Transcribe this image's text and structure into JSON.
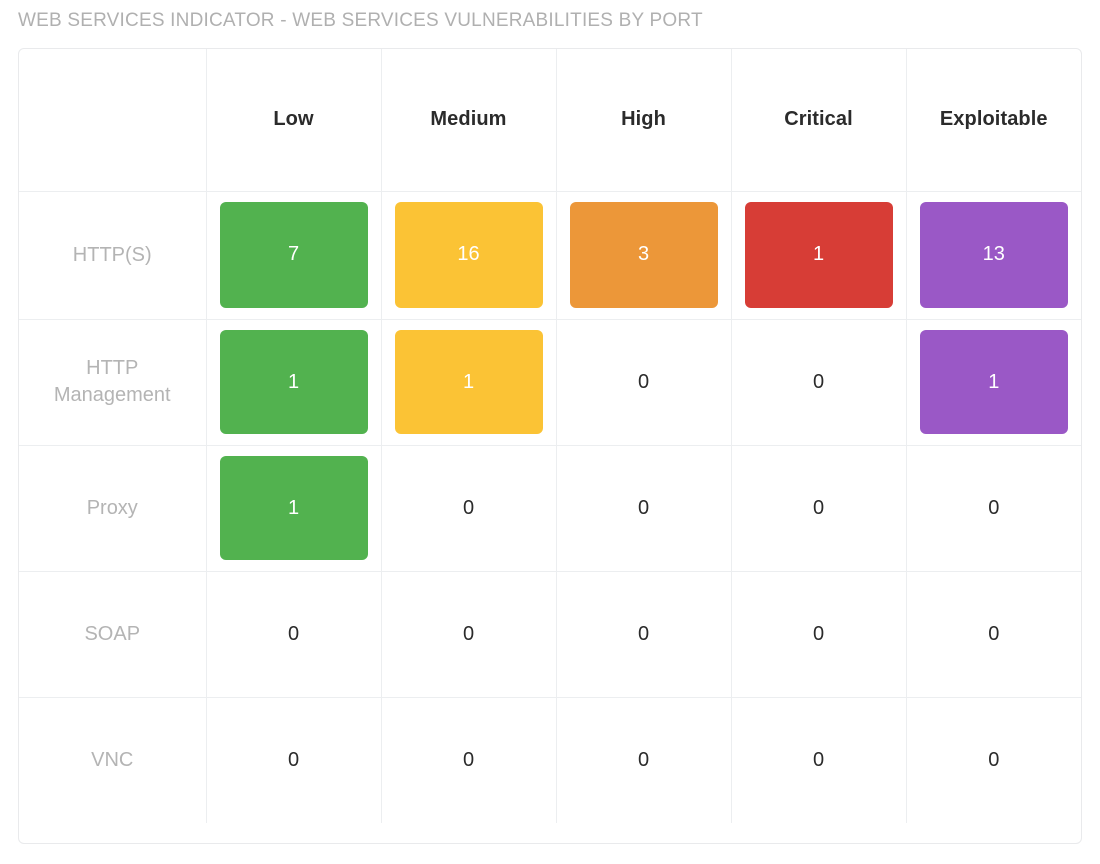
{
  "widget": {
    "title": "WEB SERVICES INDICATOR - WEB SERVICES VULNERABILITIES BY PORT",
    "title_color": "#b0b0b0",
    "card_border_color": "#e9eaec",
    "grid_line_color": "#eceef0",
    "row_label_color": "#b4b4b4",
    "header_text_color": "#2b2b2b",
    "zero_text_color": "#2b2b2b",
    "tile_text_color": "#ffffff"
  },
  "severity_colors": {
    "Low": "#52b24f",
    "Medium": "#fbc335",
    "High": "#ec9739",
    "Critical": "#d73d36",
    "Exploitable": "#9a58c6"
  },
  "chart_data": {
    "type": "heatmap",
    "title": "WEB SERVICES INDICATOR - WEB SERVICES VULNERABILITIES BY PORT",
    "xlabel": "",
    "ylabel": "",
    "legend_position": "none",
    "grid": true,
    "corner_label": "",
    "categories": [
      "Low",
      "Medium",
      "High",
      "Critical",
      "Exploitable"
    ],
    "rows": [
      "HTTP(S)",
      "HTTP Management",
      "Proxy",
      "SOAP",
      "VNC"
    ],
    "series": [
      {
        "name": "HTTP(S)",
        "values": [
          7,
          16,
          3,
          1,
          13
        ]
      },
      {
        "name": "HTTP Management",
        "values": [
          1,
          1,
          0,
          0,
          1
        ]
      },
      {
        "name": "Proxy",
        "values": [
          1,
          0,
          0,
          0,
          0
        ]
      },
      {
        "name": "SOAP",
        "values": [
          0,
          0,
          0,
          0,
          0
        ]
      },
      {
        "name": "VNC",
        "values": [
          0,
          0,
          0,
          0,
          0
        ]
      }
    ],
    "cells": [
      [
        {
          "value": "7",
          "highlighted": true,
          "severity": "Low",
          "color": "#52b24f"
        },
        {
          "value": "16",
          "highlighted": true,
          "severity": "Medium",
          "color": "#fbc335"
        },
        {
          "value": "3",
          "highlighted": true,
          "severity": "High",
          "color": "#ec9739"
        },
        {
          "value": "1",
          "highlighted": true,
          "severity": "Critical",
          "color": "#d73d36"
        },
        {
          "value": "13",
          "highlighted": true,
          "severity": "Exploitable",
          "color": "#9a58c6"
        }
      ],
      [
        {
          "value": "1",
          "highlighted": true,
          "severity": "Low",
          "color": "#52b24f"
        },
        {
          "value": "1",
          "highlighted": true,
          "severity": "Medium",
          "color": "#fbc335"
        },
        {
          "value": "0",
          "highlighted": false,
          "severity": "High",
          "color": ""
        },
        {
          "value": "0",
          "highlighted": false,
          "severity": "Critical",
          "color": ""
        },
        {
          "value": "1",
          "highlighted": true,
          "severity": "Exploitable",
          "color": "#9a58c6"
        }
      ],
      [
        {
          "value": "1",
          "highlighted": true,
          "severity": "Low",
          "color": "#52b24f"
        },
        {
          "value": "0",
          "highlighted": false,
          "severity": "Medium",
          "color": ""
        },
        {
          "value": "0",
          "highlighted": false,
          "severity": "High",
          "color": ""
        },
        {
          "value": "0",
          "highlighted": false,
          "severity": "Critical",
          "color": ""
        },
        {
          "value": "0",
          "highlighted": false,
          "severity": "Exploitable",
          "color": ""
        }
      ],
      [
        {
          "value": "0",
          "highlighted": false,
          "severity": "Low",
          "color": ""
        },
        {
          "value": "0",
          "highlighted": false,
          "severity": "Medium",
          "color": ""
        },
        {
          "value": "0",
          "highlighted": false,
          "severity": "High",
          "color": ""
        },
        {
          "value": "0",
          "highlighted": false,
          "severity": "Critical",
          "color": ""
        },
        {
          "value": "0",
          "highlighted": false,
          "severity": "Exploitable",
          "color": ""
        }
      ],
      [
        {
          "value": "0",
          "highlighted": false,
          "severity": "Low",
          "color": ""
        },
        {
          "value": "0",
          "highlighted": false,
          "severity": "Medium",
          "color": ""
        },
        {
          "value": "0",
          "highlighted": false,
          "severity": "High",
          "color": ""
        },
        {
          "value": "0",
          "highlighted": false,
          "severity": "Critical",
          "color": ""
        },
        {
          "value": "0",
          "highlighted": false,
          "severity": "Exploitable",
          "color": ""
        }
      ]
    ]
  }
}
